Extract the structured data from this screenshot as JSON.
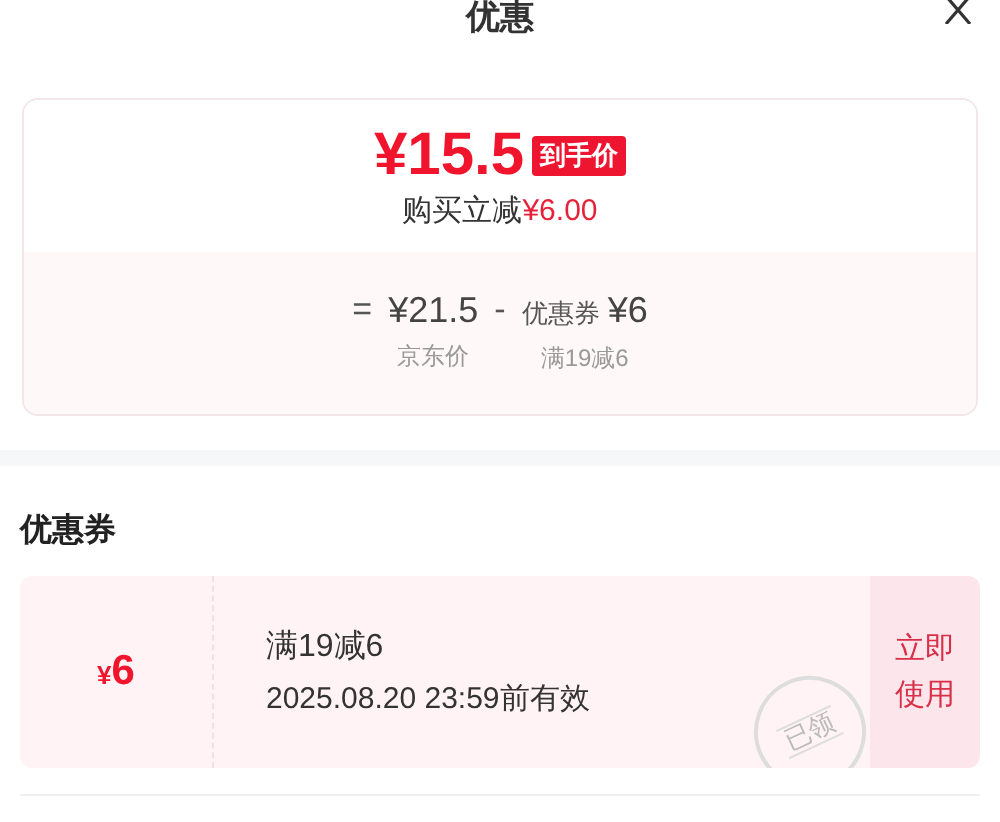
{
  "header": {
    "title": "优惠"
  },
  "price_card": {
    "price": "¥15.5",
    "price_tag": "到手价",
    "saving_label": "购买立减",
    "saving_amount": "¥6.00",
    "formula": [
      {
        "kind": "sign",
        "text": "="
      },
      {
        "kind": "amount",
        "text": "¥21.5",
        "caption": "京东价"
      },
      {
        "kind": "sign",
        "text": "-"
      },
      {
        "kind": "amount",
        "prefix": "优惠券",
        "text": "¥6",
        "caption": "满19减6"
      }
    ]
  },
  "coupons": {
    "heading": "优惠券",
    "items": [
      {
        "currency": "¥",
        "value": "6",
        "condition": "满19减6",
        "validity": "2025.08.20 23:59前有效",
        "stamp": "已领",
        "action": "立即使用"
      }
    ]
  }
}
